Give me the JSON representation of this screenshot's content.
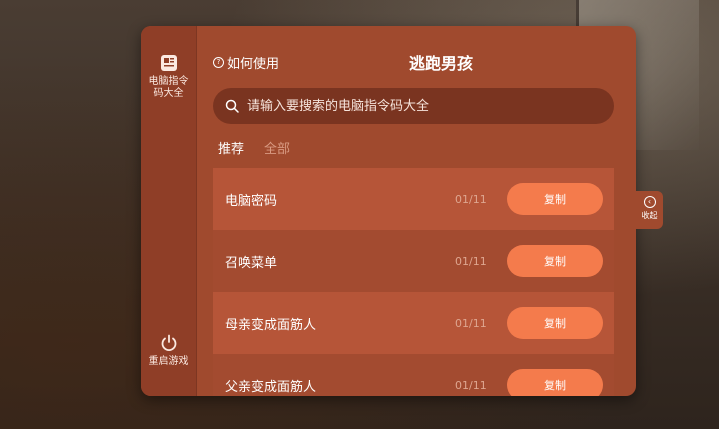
{
  "sidebar": {
    "top_item": {
      "label": "电脑指令码大全",
      "icon": "document-icon"
    },
    "bottom_item": {
      "label": "重启游戏",
      "icon": "power-icon"
    }
  },
  "header": {
    "help_label": "如何使用",
    "title": "逃跑男孩"
  },
  "search": {
    "placeholder": "请输入要搜索的电脑指令码大全"
  },
  "tabs": [
    {
      "label": "推荐",
      "active": true
    },
    {
      "label": "全部",
      "active": false
    }
  ],
  "items": [
    {
      "name": "电脑密码",
      "count": "01/11",
      "button": "复制"
    },
    {
      "name": "召唤菜单",
      "count": "01/11",
      "button": "复制"
    },
    {
      "name": "母亲变成面筋人",
      "count": "01/11",
      "button": "复制"
    },
    {
      "name": "父亲变成面筋人",
      "count": "01/11",
      "button": "复制"
    }
  ],
  "collapse": {
    "label": "收起"
  },
  "colors": {
    "panel": "#a04a2e",
    "accent_button": "#f47b4c",
    "sidebar": "#8f3e27"
  }
}
